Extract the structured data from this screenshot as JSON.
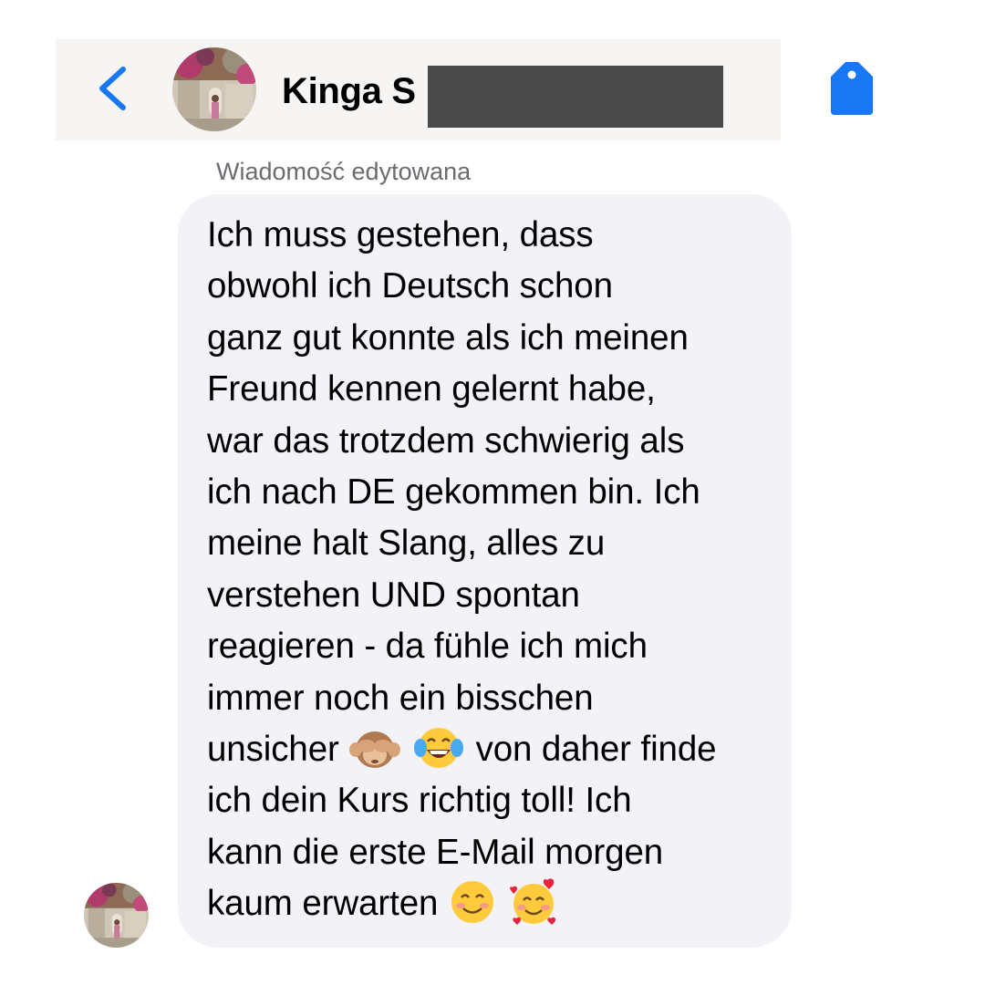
{
  "header": {
    "contact_name": "Kinga S",
    "back_icon": "chevron-left-icon",
    "tag_icon": "tag-icon",
    "accent_color": "#1877F2"
  },
  "message": {
    "edited_label": "Wiadomość edytowana",
    "lines": [
      "Ich muss gestehen, dass",
      "obwohl ich Deutsch schon",
      "ganz gut konnte als ich meinen",
      "Freund kennen gelernt habe,",
      "war das trotzdem schwierig als",
      "ich nach DE gekommen bin. Ich",
      "meine halt Slang, alles zu",
      "verstehen UND spontan",
      "reagieren - da fühle ich mich",
      "immer noch ein bisschen"
    ],
    "line_11": {
      "before": "unsicher",
      "after": "von daher finde",
      "emojis": [
        "see-no-evil-monkey-emoji",
        "tears-of-joy-emoji"
      ]
    },
    "line_12": "ich dein Kurs richtig toll! Ich",
    "line_13": "kann die erste E-Mail morgen",
    "line_14": {
      "before": "kaum erwarten",
      "emojis": [
        "smiling-face-emoji",
        "smiling-face-with-hearts-emoji"
      ]
    }
  }
}
